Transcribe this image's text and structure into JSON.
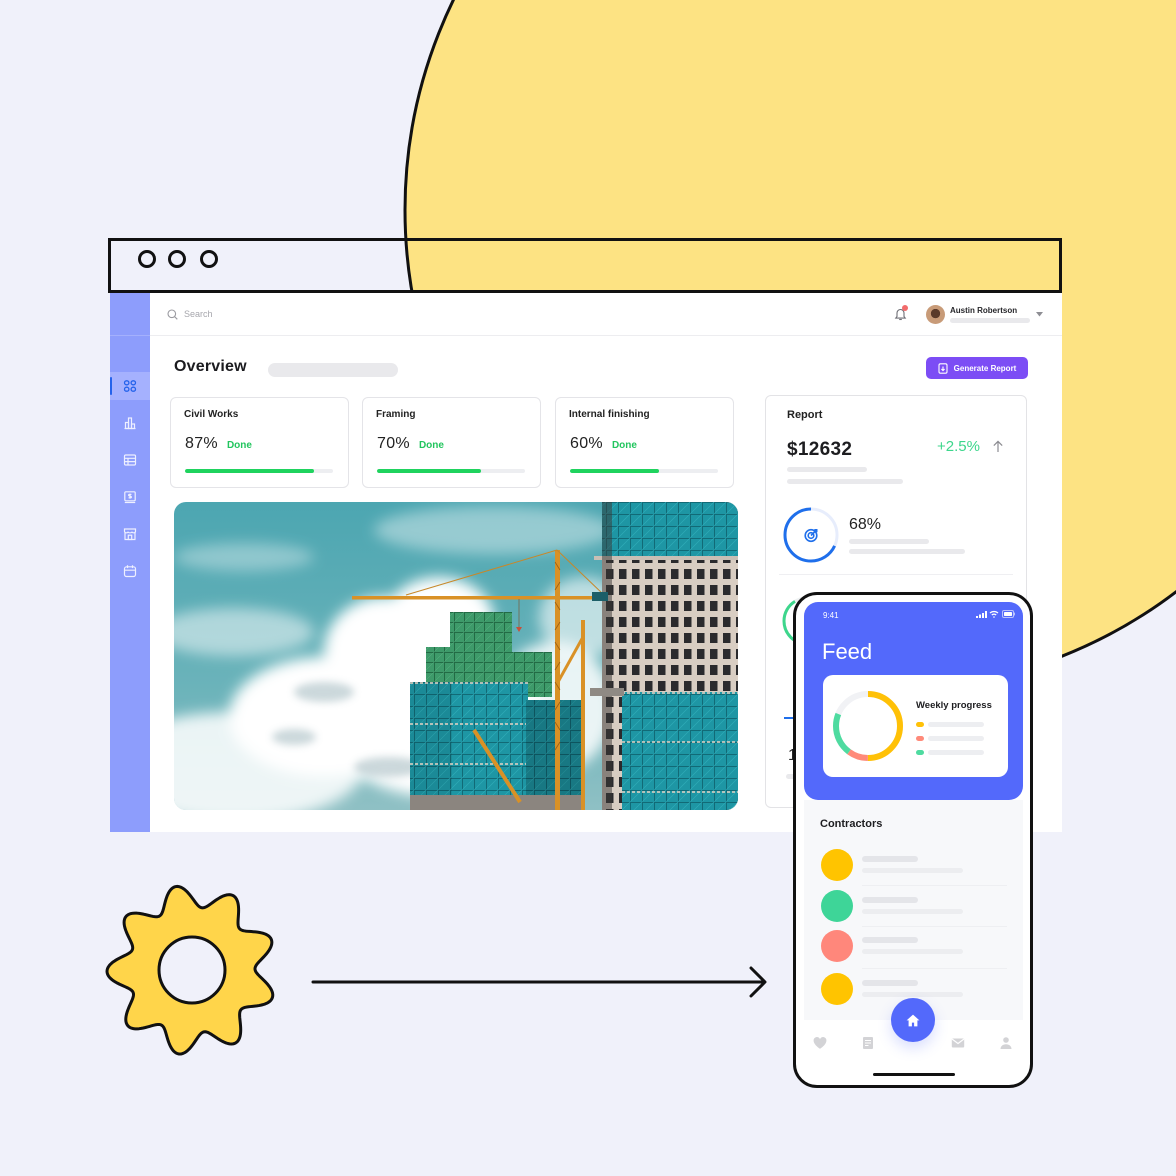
{
  "window": {
    "control_dots": [
      "window-dot",
      "window-dot",
      "window-dot"
    ]
  },
  "header": {
    "search_placeholder": "Search",
    "user_name": "Austin Robertson",
    "has_notification": true
  },
  "sidebar": {
    "items": [
      {
        "icon": "grid-icon",
        "active": true
      },
      {
        "icon": "bar-chart-icon",
        "active": false
      },
      {
        "icon": "table-icon",
        "active": false
      },
      {
        "icon": "invoice-icon",
        "active": false
      },
      {
        "icon": "store-icon",
        "active": false
      },
      {
        "icon": "calendar-icon",
        "active": false
      }
    ]
  },
  "page": {
    "title": "Overview",
    "generate_report_label": "Generate Report"
  },
  "progress_cards": [
    {
      "title": "Civil Works",
      "percent_label": "87%",
      "value": 87,
      "status": "Done"
    },
    {
      "title": "Framing",
      "percent_label": "70%",
      "value": 70,
      "status": "Done"
    },
    {
      "title": "Internal finishing",
      "percent_label": "60%",
      "value": 60,
      "status": "Done"
    }
  ],
  "report": {
    "title": "Report",
    "amount": "$12632",
    "change": "+2.5%",
    "change_direction": "up",
    "target_label": "68%",
    "target_value": 68,
    "partial_value": "1"
  },
  "mobile": {
    "status_time": "9:41",
    "title": "Feed",
    "weekly_progress": {
      "title": "Weekly progress",
      "segments": [
        {
          "color": "#FFC107",
          "fraction": 0.5
        },
        {
          "color": "#FF8A7A",
          "fraction": 0.1
        },
        {
          "color": "#4EDBA0",
          "fraction": 0.21
        }
      ],
      "track_color": "#F1F2F5"
    },
    "contractors_title": "Contractors",
    "contractors": [
      {
        "avatar_color": "#FFC400"
      },
      {
        "avatar_color": "#3ED598"
      },
      {
        "avatar_color": "#FF877B"
      },
      {
        "avatar_color": "#FFC400"
      }
    ],
    "nav": [
      "heart-icon",
      "document-icon",
      "home-icon",
      "mail-icon",
      "user-icon"
    ],
    "active_nav": "home-icon"
  },
  "colors": {
    "background": "#F0F1FA",
    "decor_circle": "#FDE383",
    "gear": "#FFD54A",
    "sidebar": "#8D9DFC",
    "primary_button": "#7C4DF5",
    "progress_fill": "#1FD35E",
    "done_text": "#22C55E",
    "positive_change": "#3DD68C",
    "mobile_accent": "#5369FB",
    "report_ring": "#1F6FEB"
  }
}
